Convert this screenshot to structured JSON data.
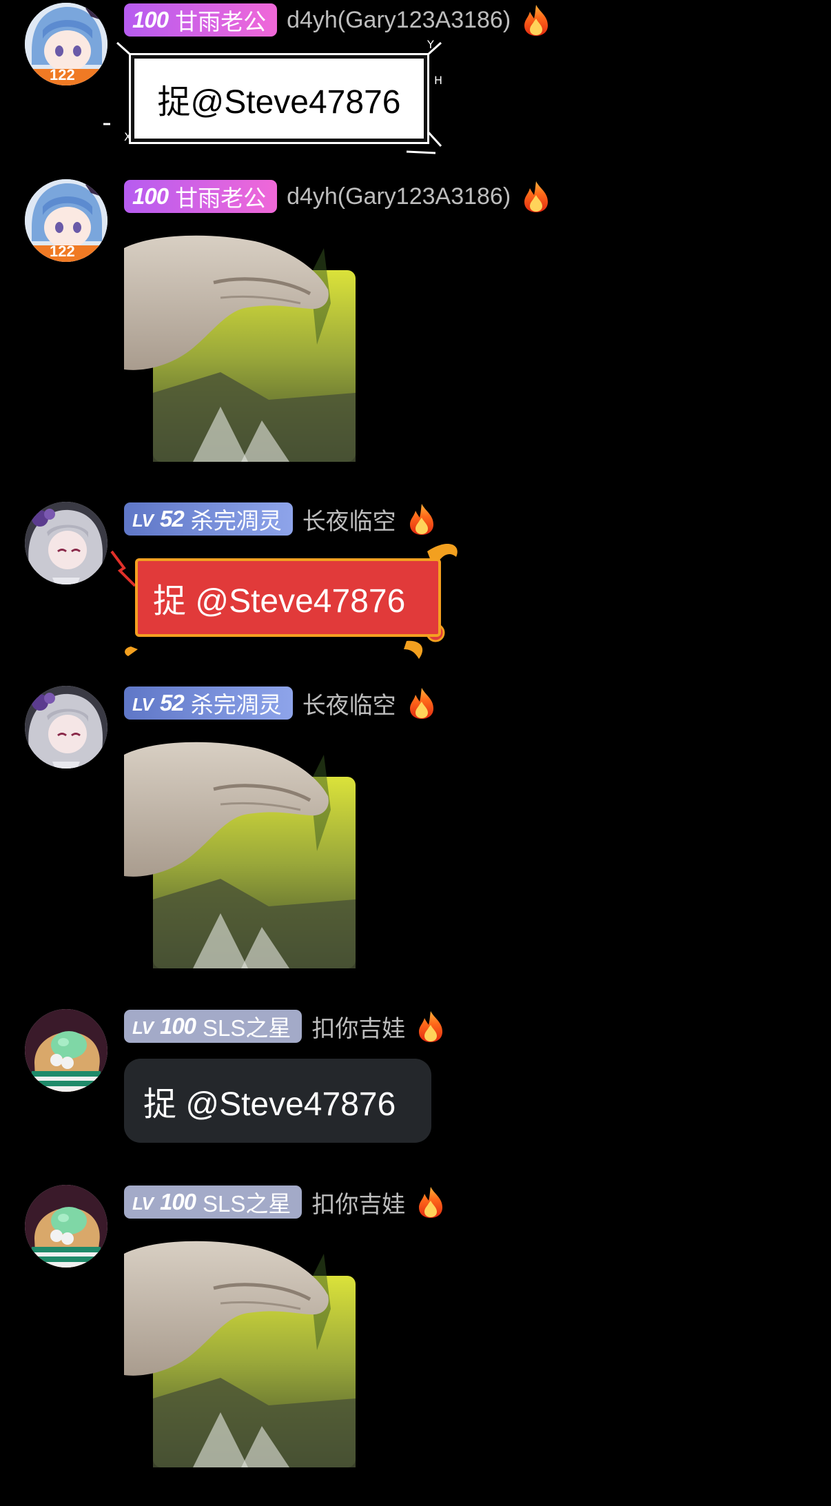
{
  "messages": [
    {
      "user": {
        "level": "100",
        "level_prefix": "",
        "title": "甘雨老公",
        "name": "d4yh(Gary123A3186)",
        "badge_style": "pink",
        "avatar": "blue-hair-anime-avatar",
        "avatar_tag": "122"
      },
      "content": {
        "type": "text",
        "style": "box-frame",
        "text": "捉@Steve47876"
      }
    },
    {
      "user": {
        "level": "100",
        "level_prefix": "",
        "title": "甘雨老公",
        "name": "d4yh(Gary123A3186)",
        "badge_style": "pink",
        "avatar": "blue-hair-anime-avatar",
        "avatar_tag": "122"
      },
      "content": {
        "type": "sticker",
        "sticker": "hand-pinch-forest-sticker"
      }
    },
    {
      "user": {
        "level": "52",
        "level_prefix": "LV",
        "title": "杀完凋灵",
        "name": "长夜临空",
        "badge_style": "blue",
        "avatar": "silver-hair-anime-avatar"
      },
      "content": {
        "type": "text",
        "style": "red-flame-frame",
        "text": "捉 @Steve47876"
      }
    },
    {
      "user": {
        "level": "52",
        "level_prefix": "LV",
        "title": "杀完凋灵",
        "name": "长夜临空",
        "badge_style": "blue",
        "avatar": "silver-hair-anime-avatar"
      },
      "content": {
        "type": "sticker",
        "sticker": "hand-pinch-forest-sticker"
      }
    },
    {
      "user": {
        "level": "100",
        "level_prefix": "LV",
        "title": "SLS之星",
        "name": "扣你吉娃",
        "badge_style": "gray",
        "avatar": "green-creature-avatar"
      },
      "content": {
        "type": "text",
        "style": "dark-bubble",
        "text": "捉 @Steve47876"
      }
    },
    {
      "user": {
        "level": "100",
        "level_prefix": "LV",
        "title": "SLS之星",
        "name": "扣你吉娃",
        "badge_style": "gray",
        "avatar": "green-creature-avatar"
      },
      "content": {
        "type": "sticker",
        "sticker": "hand-pinch-forest-sticker"
      }
    }
  ],
  "icons": {
    "flame": "fire-icon"
  },
  "colors": {
    "background": "#000000",
    "badge_pink": "#d060e8",
    "badge_blue": "#7088d8",
    "badge_gray": "#a3aac8",
    "bubble_red": "#e13a3a",
    "bubble_dark": "#24272b"
  }
}
